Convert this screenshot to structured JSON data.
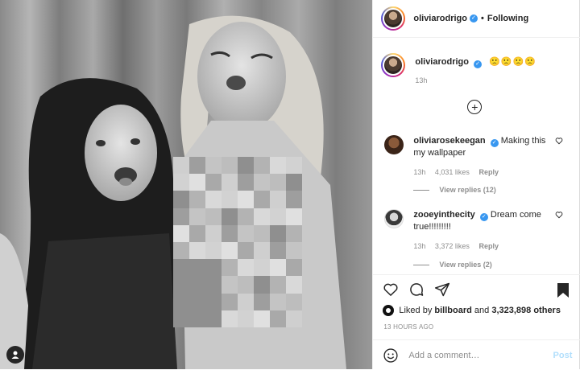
{
  "post": {
    "author": "oliviarodrigo",
    "follow_status": "Following",
    "caption_emojis": "🙁🙁🙁🙁",
    "caption_age": "13h"
  },
  "comments": [
    {
      "username": "oliviarosekeegan",
      "text": "Making this my wallpaper",
      "age": "13h",
      "likes": "4,031 likes",
      "reply": "Reply",
      "view_replies": "View replies (12)"
    },
    {
      "username": "zooeyinthecity",
      "text": "Dream come true!!!!!!!!!",
      "age": "13h",
      "likes": "3,372 likes",
      "reply": "Reply",
      "view_replies": "View replies (2)"
    }
  ],
  "likes": {
    "prefix": "Liked by",
    "user": "billboard",
    "conjunction": "and",
    "others": "3,323,898 others"
  },
  "timestamp": "13 HOURS AGO",
  "comment_box": {
    "placeholder": "Add a comment…",
    "post_label": "Post"
  },
  "icons": {
    "like": "heart-icon",
    "comment": "comment-icon",
    "share": "paper-plane-icon",
    "save": "bookmark-icon",
    "emoji": "smiley-icon",
    "load_more": "plus-circle-icon",
    "tagged_user": "user-tag-icon"
  },
  "colors": {
    "verified": "#3897f0",
    "post_button_disabled": "#b2dffc",
    "muted_text": "#8e8e8e"
  }
}
